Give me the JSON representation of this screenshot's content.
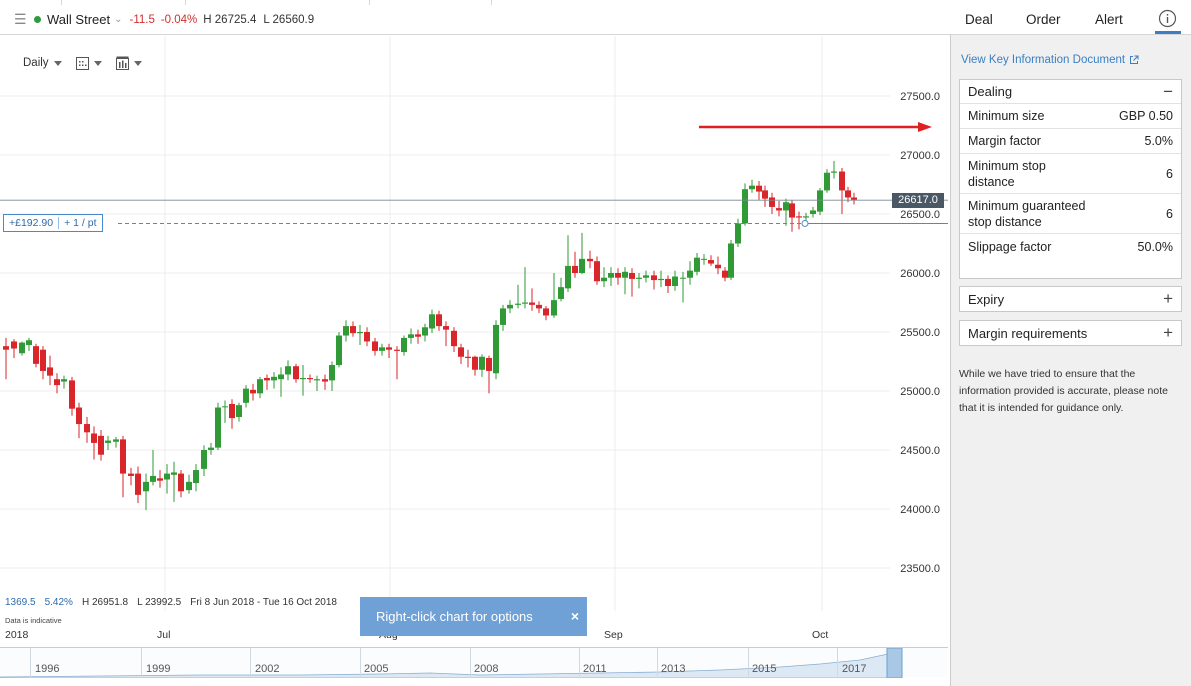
{
  "header": {
    "market_name": "Wall Street",
    "change": "-11.5",
    "change_pct": "-0.04%",
    "high": "H 26725.4",
    "low": "L 26560.9"
  },
  "tabs": {
    "deal": "Deal",
    "order": "Order",
    "alert": "Alert"
  },
  "toolbar": {
    "interval": "Daily"
  },
  "chart": {
    "price_axis": [
      "27500.0",
      "27000.0",
      "26500.0",
      "26000.0",
      "25500.0",
      "25000.0",
      "24500.0",
      "24000.0",
      "23500.0"
    ],
    "current_price": "26617.0",
    "pl": "+£192.90",
    "per_point": "+ 1 / pt",
    "date_axis": [
      "2018",
      "Jul",
      "Aug",
      "Sep",
      "Oct"
    ],
    "stats": {
      "change": "1369.5",
      "change_pct": "5.42%",
      "high": "H 26951.8",
      "low": "L 23992.5",
      "range": "Fri 8 Jun 2018 - Tue 16 Oct 2018"
    },
    "indicative": "Data is indicative",
    "navigator_years": [
      "1996",
      "1999",
      "2002",
      "2005",
      "2008",
      "2011",
      "2013",
      "2015",
      "2017"
    ],
    "colors": {
      "up": "#2f9a36",
      "down": "#d8262a",
      "annotation_arrow": "#e02020"
    }
  },
  "toast": {
    "text": "Right-click chart for options",
    "close": "×"
  },
  "side": {
    "kid_link": "View Key Information Document",
    "dealing": {
      "title": "Dealing",
      "rows": [
        {
          "label": "Minimum size",
          "value": "GBP 0.50"
        },
        {
          "label": "Margin factor",
          "value": "5.0%"
        },
        {
          "label": "Minimum stop distance",
          "value": "6"
        },
        {
          "label": "Minimum guaranteed stop distance",
          "value": "6"
        },
        {
          "label": "Slippage factor",
          "value": "50.0%"
        }
      ]
    },
    "expiry": "Expiry",
    "margin": "Margin requirements",
    "disclaimer": "While we have tried to ensure that the information provided is accurate, please note that it is intended for guidance only."
  }
}
